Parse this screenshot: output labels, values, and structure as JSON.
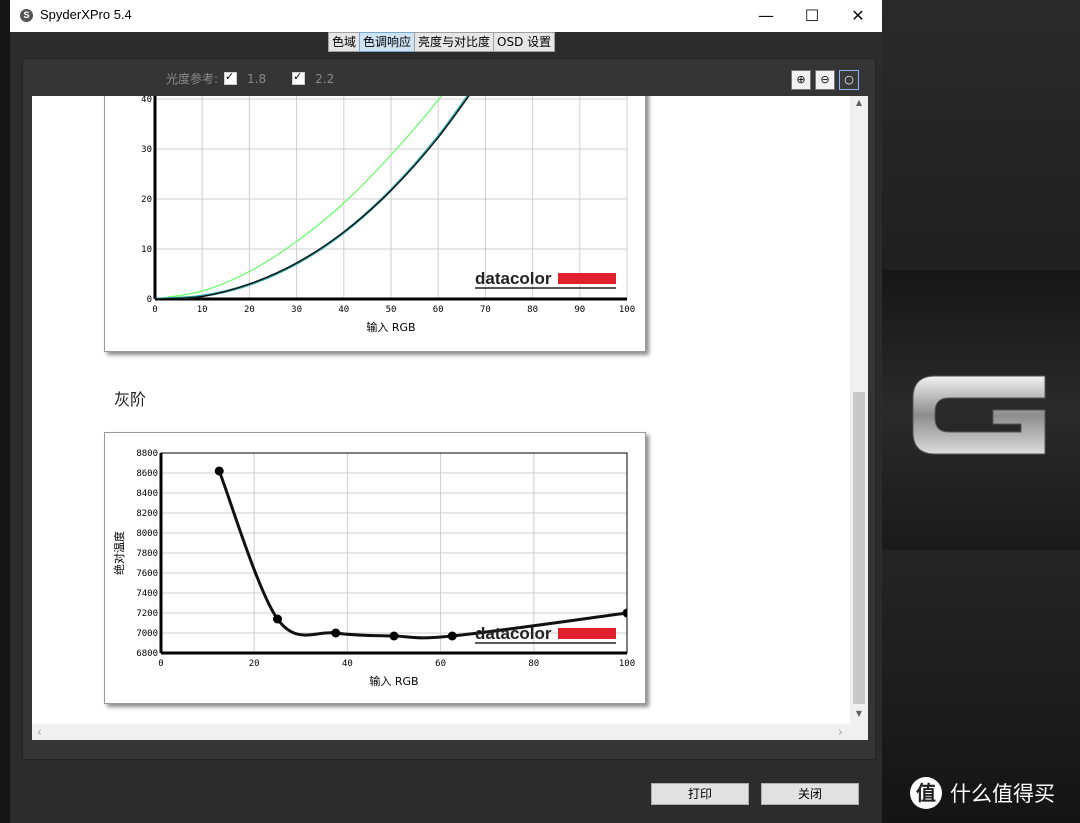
{
  "window": {
    "title": "SpyderXPro 5.4",
    "min": "—",
    "max": "☐",
    "close": "✕"
  },
  "tabs": [
    {
      "label": "色域",
      "active": false
    },
    {
      "label": "色调响应",
      "active": true
    },
    {
      "label": "亮度与对比度",
      "active": false
    },
    {
      "label": "OSD 设置",
      "active": false
    }
  ],
  "toolbar": {
    "ref_label": "光度参考:",
    "gamma_options": [
      {
        "value": "1.8",
        "checked": true
      },
      {
        "value": "2.2",
        "checked": true
      }
    ],
    "zoom_in_icon": "zoom-in-icon",
    "zoom_out_icon": "zoom-out-icon",
    "zoom_fit_icon": "zoom-fit-icon"
  },
  "section_gray": "灰阶",
  "brand_logo": "datacolor",
  "colors": {
    "brand_red": "#e0202c",
    "gamma18": "#66ff66",
    "gamma22": "#2aa7a7",
    "measured": "#111111"
  },
  "chart_data": [
    {
      "type": "line",
      "xlabel": "输入 RGB",
      "ylabel": "",
      "xlim": [
        0,
        100
      ],
      "ylim": [
        0,
        44
      ],
      "xticks": [
        0,
        10,
        20,
        30,
        40,
        50,
        60,
        70,
        80,
        90,
        100
      ],
      "yticks": [
        0,
        10,
        20,
        30,
        40
      ],
      "grid": true,
      "series": [
        {
          "style": "gamma 1.8",
          "x": [
            0,
            10,
            20,
            30,
            40,
            50,
            60,
            70
          ],
          "y": [
            0,
            1.6,
            5.5,
            11.5,
            19.2,
            28.8,
            39.8,
            52.5
          ]
        },
        {
          "style": "gamma 2.2",
          "x": [
            0,
            10,
            20,
            30,
            40,
            50,
            60,
            70
          ],
          "y": [
            0,
            0.6,
            2.9,
            7.1,
            13.3,
            21.8,
            32.5,
            45.6
          ]
        },
        {
          "style": "measured",
          "x": [
            0,
            10,
            20,
            30,
            40,
            50,
            60,
            70
          ],
          "y": [
            0,
            0.5,
            3.0,
            7.2,
            13.4,
            21.7,
            32.3,
            45.3
          ]
        }
      ]
    },
    {
      "type": "line",
      "xlabel": "输入 RGB",
      "ylabel": "绝对温度",
      "xlim": [
        0,
        100
      ],
      "ylim": [
        6800,
        8800
      ],
      "xticks": [
        0,
        20,
        40,
        60,
        80,
        100
      ],
      "yticks": [
        6800,
        7000,
        7200,
        7400,
        7600,
        7800,
        8000,
        8200,
        8400,
        8600,
        8800
      ],
      "grid": true,
      "series": [
        {
          "style": "measured",
          "x": [
            12.5,
            25,
            37.5,
            50,
            62.5,
            100
          ],
          "y": [
            8620,
            7140,
            7000,
            6970,
            6970,
            7200
          ]
        }
      ]
    }
  ],
  "buttons": {
    "print": "打印",
    "close": "关闭"
  },
  "watermark": {
    "icon": "值",
    "text": "什么值得买"
  },
  "desktop_logo": "G"
}
